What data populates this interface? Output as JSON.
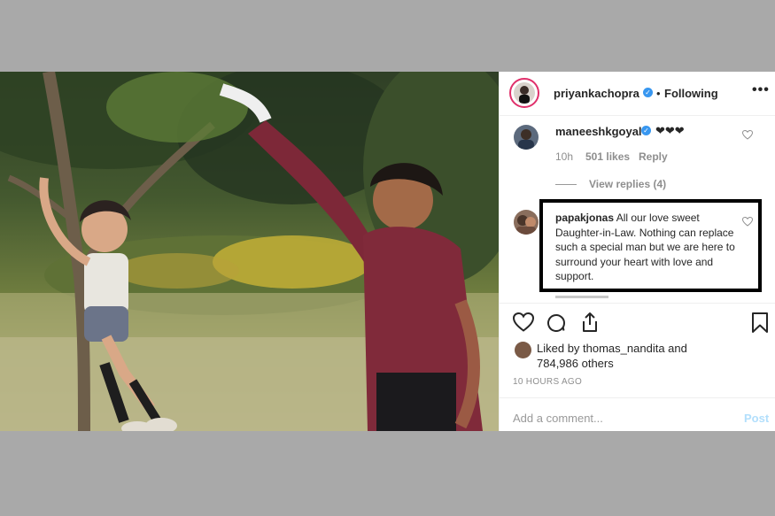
{
  "post": {
    "owner_username": "priyankachopra",
    "follow_separator": "•",
    "follow_status": "Following",
    "more_options_glyph": "•••"
  },
  "comments": [
    {
      "username": "maneeshkgoyal",
      "text": "❤❤❤",
      "time": "10h",
      "likes": "501 likes",
      "reply_label": "Reply",
      "view_replies": "View replies (4)"
    },
    {
      "username": "papakjonas",
      "text": "All our love sweet Daughter-in-Law. Nothing can replace such a special man but we are here to surround your heart with love and support."
    }
  ],
  "likes": {
    "line1": "Liked by thomas_nandita and",
    "line2": "784,986 others"
  },
  "timestamp": "10 HOURS AGO",
  "comment_box": {
    "placeholder": "Add a comment...",
    "post_label": "Post"
  },
  "colors": {
    "verified_blue": "#3897f0",
    "highlight_border": "#000000",
    "background_gray": "#a9a9a9"
  },
  "icons": [
    "verified-icon",
    "heart-icon",
    "comment-icon",
    "share-icon",
    "save-icon",
    "more-options-icon"
  ]
}
